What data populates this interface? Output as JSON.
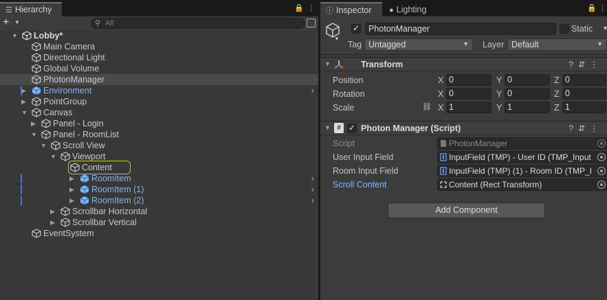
{
  "hierarchy": {
    "tab_label": "Hierarchy",
    "search_placeholder": "All",
    "rows": [
      {
        "label": "Lobby*",
        "depth": 0,
        "fold": "open",
        "kind": "scene"
      },
      {
        "label": "Main Camera",
        "depth": 1,
        "fold": "none",
        "kind": "object"
      },
      {
        "label": "Directional Light",
        "depth": 1,
        "fold": "none",
        "kind": "object"
      },
      {
        "label": "Global Volume",
        "depth": 1,
        "fold": "none",
        "kind": "object"
      },
      {
        "label": "PhotonManager",
        "depth": 1,
        "fold": "none",
        "kind": "object",
        "selected": true
      },
      {
        "label": "Environment",
        "depth": 1,
        "fold": "closed",
        "kind": "prefab",
        "chevron": true
      },
      {
        "label": "PointGroup",
        "depth": 1,
        "fold": "closed",
        "kind": "object"
      },
      {
        "label": "Canvas",
        "depth": 1,
        "fold": "open",
        "kind": "object"
      },
      {
        "label": "Panel - Login",
        "depth": 2,
        "fold": "closed",
        "kind": "object"
      },
      {
        "label": "Panel - RoomList",
        "depth": 2,
        "fold": "open",
        "kind": "object"
      },
      {
        "label": "Scroll View",
        "depth": 3,
        "fold": "open",
        "kind": "object"
      },
      {
        "label": "Viewport",
        "depth": 4,
        "fold": "open",
        "kind": "object"
      },
      {
        "label": "Content",
        "depth": 5,
        "fold": "none",
        "kind": "object",
        "outlined": true
      },
      {
        "label": "RoomItem",
        "depth": 6,
        "fold": "closed",
        "kind": "prefab",
        "chevron": true
      },
      {
        "label": "RoomItem (1)",
        "depth": 6,
        "fold": "closed",
        "kind": "prefab",
        "chevron": true
      },
      {
        "label": "RoomItem (2)",
        "depth": 6,
        "fold": "closed",
        "kind": "prefab",
        "chevron": true
      },
      {
        "label": "Scrollbar Horizontal",
        "depth": 4,
        "fold": "closed",
        "kind": "object"
      },
      {
        "label": "Scrollbar Vertical",
        "depth": 4,
        "fold": "closed",
        "kind": "object"
      },
      {
        "label": "EventSystem",
        "depth": 1,
        "fold": "none",
        "kind": "object"
      }
    ]
  },
  "inspector": {
    "tab_inspector": "Inspector",
    "tab_lighting": "Lighting",
    "object_name": "PhotonManager",
    "static_label": "Static",
    "tag_label": "Tag",
    "tag_value": "Untagged",
    "layer_label": "Layer",
    "layer_value": "Default",
    "transform": {
      "title": "Transform",
      "position_label": "Position",
      "rotation_label": "Rotation",
      "scale_label": "Scale",
      "axes": [
        "X",
        "Y",
        "Z"
      ],
      "position": [
        "0",
        "0",
        "0"
      ],
      "rotation": [
        "0",
        "0",
        "0"
      ],
      "scale": [
        "1",
        "1",
        "1"
      ]
    },
    "script_component": {
      "title": "Photon Manager (Script)",
      "script_label": "Script",
      "script_value": "PhotonManager",
      "user_input_label": "User Input Field",
      "user_input_value": "InputField (TMP) - User ID (TMP_Input",
      "room_input_label": "Room Input Field",
      "room_input_value": "InputField (TMP) (1) - Room ID (TMP_I",
      "scroll_content_label": "Scroll Content",
      "scroll_content_value": "Content (Rect Transform)"
    },
    "add_component_label": "Add Component"
  },
  "colors": {
    "prefab_blue": "#7cb6ff",
    "selection_outline": "#c6c62b",
    "modified_label": "#7cb6ff"
  }
}
